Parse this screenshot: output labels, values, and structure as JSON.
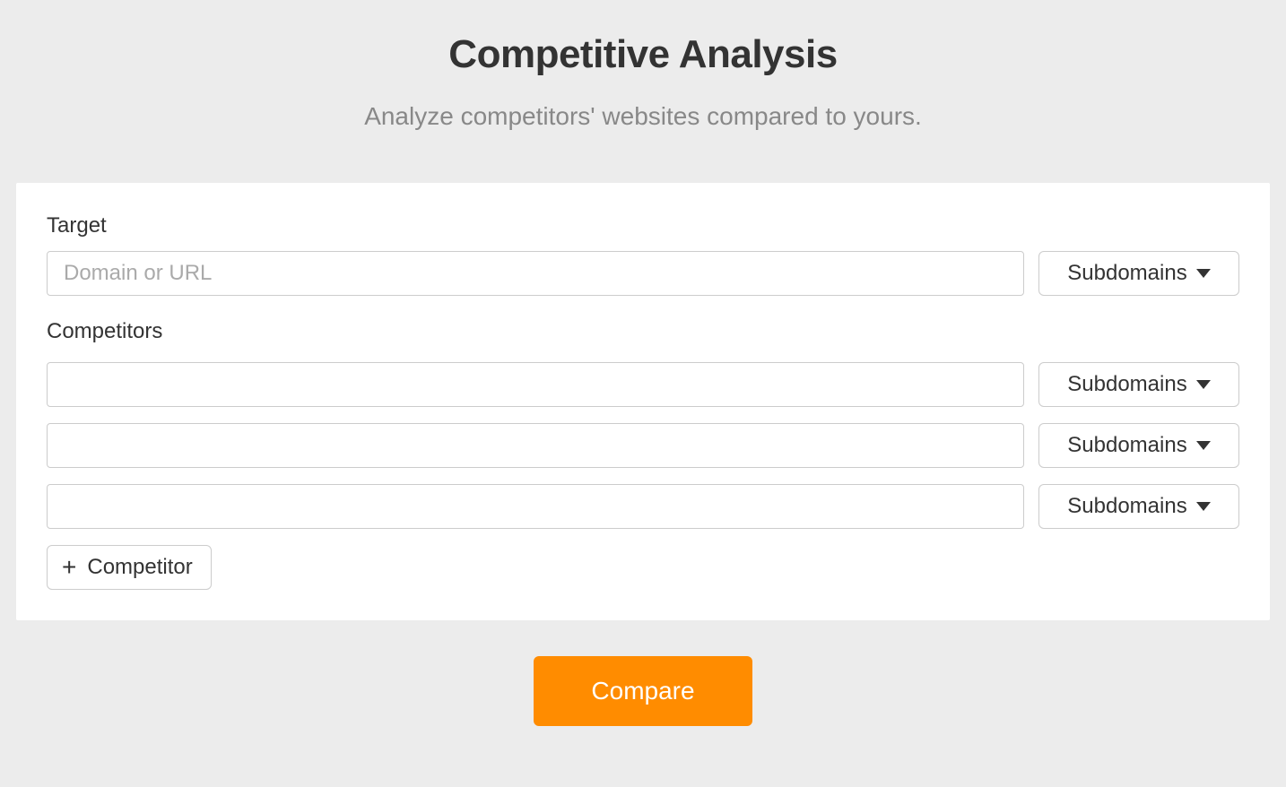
{
  "header": {
    "title": "Competitive Analysis",
    "subtitle": "Analyze competitors' websites compared to yours."
  },
  "form": {
    "target": {
      "label": "Target",
      "placeholder": "Domain or URL",
      "value": "",
      "mode_selected": "Subdomains"
    },
    "competitors": {
      "label": "Competitors",
      "rows": [
        {
          "value": "",
          "mode_selected": "Subdomains"
        },
        {
          "value": "",
          "mode_selected": "Subdomains"
        },
        {
          "value": "",
          "mode_selected": "Subdomains"
        }
      ],
      "add_button_label": "Competitor"
    },
    "compare_button_label": "Compare"
  }
}
